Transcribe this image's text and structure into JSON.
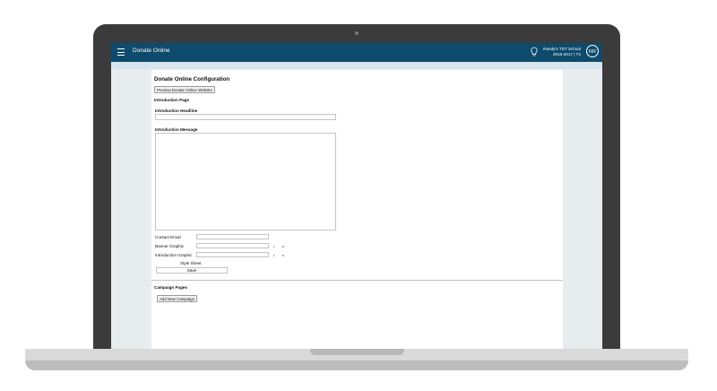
{
  "topbar": {
    "app_title": "Donate Online",
    "school_name": "Randy's TDT School",
    "school_term": "2016-2017 | T4",
    "avatar_initials": "RR"
  },
  "page": {
    "title": "Donate Online Configuration",
    "preview_button": "Preview Donate Online Website",
    "intro_section": "Introduction Page",
    "headline_label": "Introduction Headline",
    "message_label": "Introduction Message",
    "contact_email_label": "Contact Email",
    "banner_label": "Banner Graphic",
    "intro_graphic_label": "Introduction Graphic",
    "small_button_glyph": "•",
    "remove_glyph": "x",
    "style_sheet_button": "Style Sheet",
    "save_button": "Save",
    "campaign_section": "Campaign Pages",
    "add_campaign_button": "Add New Campaign"
  },
  "colors": {
    "topbar": "#0e4a6b",
    "subbar": "#d7e5ec"
  }
}
